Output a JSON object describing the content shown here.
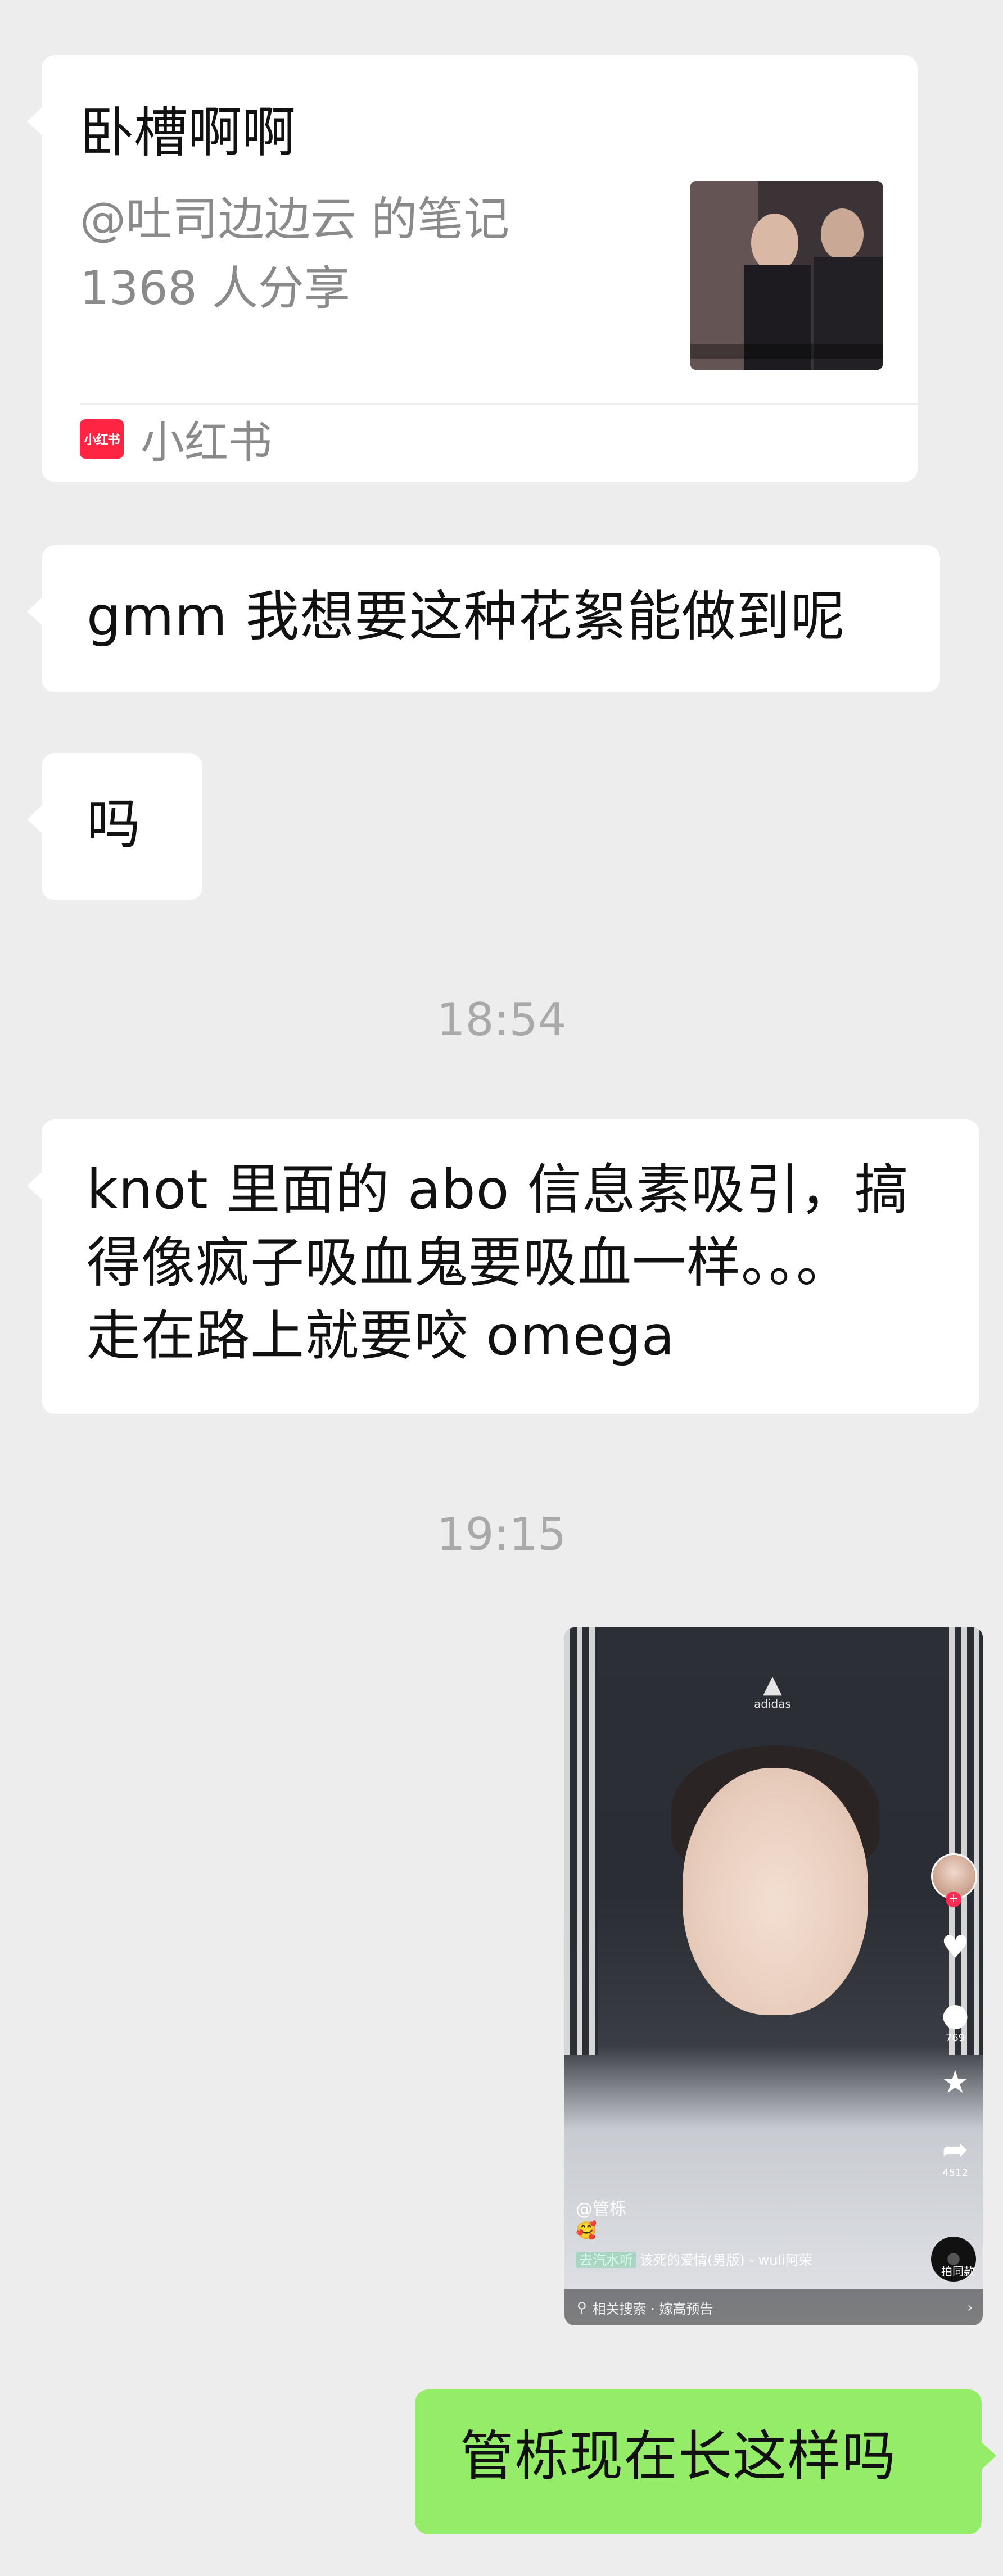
{
  "colors": {
    "background": "#ededed",
    "incoming_bubble": "#ffffff",
    "outgoing_bubble": "#95ec69",
    "timestamp": "#a9a9a9",
    "xiaohongshu_brand": "#ff2442"
  },
  "shared_card": {
    "title": "卧槽啊啊",
    "author_line": "@吐司边边云 的笔记",
    "share_count": "1368 人分享",
    "source_logo_text": "小红书",
    "source_name": "小红书",
    "thumbnail_icon": "video-thumbnail-image"
  },
  "messages": [
    {
      "side": "incoming",
      "text": "gmm 我想要这种花絮能做到呢"
    },
    {
      "side": "incoming",
      "text": "吗"
    },
    {
      "side": "timestamp",
      "text": "18:54"
    },
    {
      "side": "incoming",
      "text": "knot 里面的 abo 信息素吸引，搞\n得像疯子吸血鬼要吸血一样。。。\n走在路上就要咬 omega"
    },
    {
      "side": "timestamp",
      "text": "19:15"
    },
    {
      "side": "outgoing",
      "text": "管栎现在长这样吗"
    }
  ],
  "shared_video": {
    "brand_text": "adidas",
    "like_count": "",
    "comment_count": "769",
    "favorite_count": "",
    "share_count": "4512",
    "author": "@管栎",
    "emoji": "🥰",
    "music_tag": "去汽水听",
    "music_title": "该死的爱情(男版) - wuli阿荣",
    "disc_label": "拍同款",
    "search_text": "相关搜索 · 嫁高预告"
  }
}
